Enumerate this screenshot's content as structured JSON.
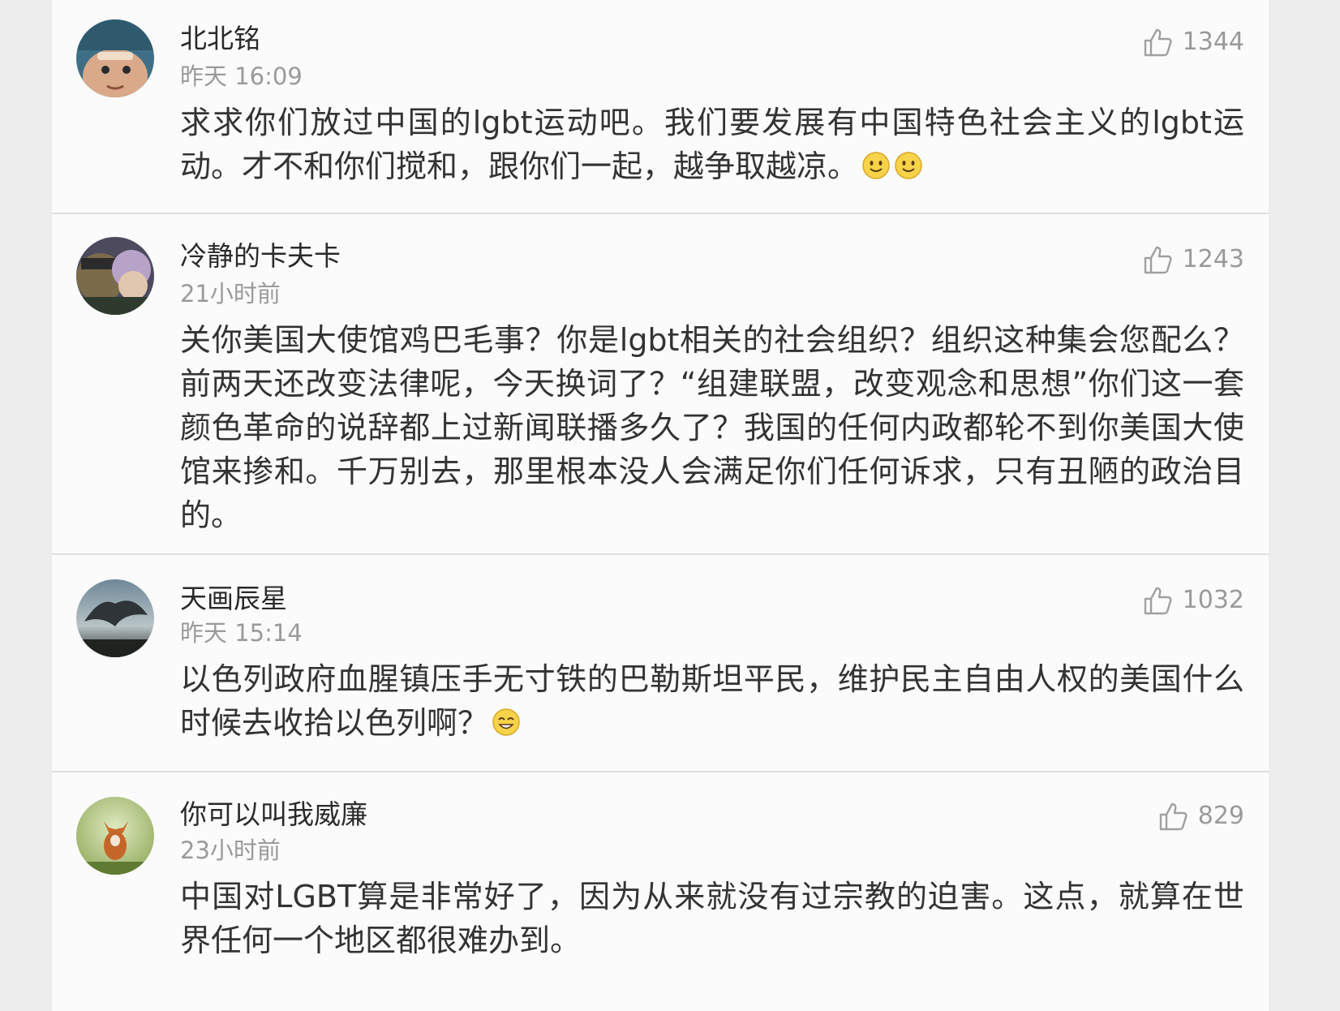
{
  "comments": [
    {
      "username": "北北铭",
      "time": "昨天 16:09",
      "likes": "1344",
      "text": "求求你们放过中国的lgbt运动吧。我们要发展有中国特色社会主义的lgbt运动。才不和你们搅和，跟你们一起，越争取越凉。",
      "emojis": [
        "smile-emoji",
        "smile-emoji"
      ]
    },
    {
      "username": "冷静的卡夫卡",
      "time": "21小时前",
      "likes": "1243",
      "text": "关你美国大使馆鸡巴毛事？你是lgbt相关的社会组织？组织这种集会您配么？前两天还改变法律呢，今天换词了？“组建联盟，改变观念和思想”你们这一套颜色革命的说辞都上过新闻联播多久了？我国的任何内政都轮不到你美国大使馆来掺和。千万别去，那里根本没人会满足你们任何诉求，只有丑陋的政治目的。",
      "emojis": []
    },
    {
      "username": "天画辰星",
      "time": "昨天 15:14",
      "likes": "1032",
      "text": "以色列政府血腥镇压手无寸铁的巴勒斯坦平民，维护民主自由人权的美国什么时候去收拾以色列啊？",
      "emojis": [
        "grin-emoji"
      ]
    },
    {
      "username": "你可以叫我威廉",
      "time": "23小时前",
      "likes": "829",
      "text": "中国对LGBT算是非常好了，因为从来就没有过宗教的迫害。这点，就算在世界任何一个地区都很难办到。",
      "emojis": []
    }
  ],
  "icons": {
    "like": "thumbs-up-icon"
  },
  "colors": {
    "background": "#fbfbfb",
    "divider": "#dedede",
    "username": "#2a2a2a",
    "meta": "#9a9a9a",
    "body_text": "#333333"
  }
}
